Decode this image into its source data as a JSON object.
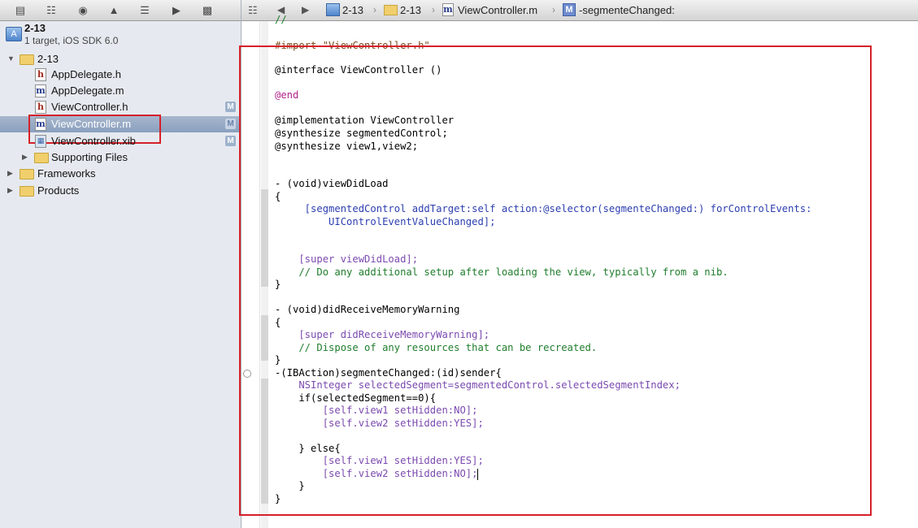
{
  "navigator": {
    "toolbar_icons": [
      "folder-icon",
      "hierarchy-icon",
      "search-icon",
      "warning-icon",
      "test-icon",
      "breakpoint-icon",
      "log-icon"
    ],
    "project": {
      "title": "2-13",
      "subtitle": "1 target, iOS SDK 6.0"
    },
    "tree": [
      {
        "label": "2-13",
        "kind": "group",
        "expanded": true
      },
      {
        "label": "AppDelegate.h",
        "kind": "h"
      },
      {
        "label": "AppDelegate.m",
        "kind": "m"
      },
      {
        "label": "ViewController.h",
        "kind": "h",
        "badge": "M"
      },
      {
        "label": "ViewController.m",
        "kind": "m",
        "badge": "M",
        "selected": true
      },
      {
        "label": "ViewController.xib",
        "kind": "xib",
        "badge": "M"
      },
      {
        "label": "Supporting Files",
        "kind": "group",
        "expanded": false
      },
      {
        "label": "Frameworks",
        "kind": "group",
        "expanded": false
      },
      {
        "label": "Products",
        "kind": "group",
        "expanded": false
      }
    ],
    "badge_letter": "M"
  },
  "editor_header": {
    "breadcrumbs": [
      "2-13",
      "2-13",
      "ViewController.m",
      "-segmenteChanged:"
    ],
    "method_badge": "M"
  },
  "code": {
    "lines": [
      "//",
      "#import \"ViewController.h\"",
      "@interface ViewController ()",
      "@end",
      "@implementation ViewController",
      "@synthesize segmentedControl;",
      "@synthesize view1,view2;",
      "- (void)viewDidLoad",
      "{",
      "     [segmentedControl addTarget:self action:@selector(segmenteChanged:) forControlEvents:",
      "         UIControlEventValueChanged];",
      "    [super viewDidLoad];",
      "    // Do any additional setup after loading the view, typically from a nib.",
      "}",
      "- (void)didReceiveMemoryWarning",
      "{",
      "    [super didReceiveMemoryWarning];",
      "    // Dispose of any resources that can be recreated.",
      "}",
      "-(IBAction)segmenteChanged:(id)sender{",
      "    NSInteger selectedSegment=segmentedControl.selectedSegmentIndex;",
      "    if(selectedSegment==0){",
      "        [self.view1 setHidden:NO];",
      "        [self.view2 setHidden:YES];",
      "    } else{",
      "        [self.view1 setHidden:YES];",
      "        [self.view2 setHidden:NO];",
      "    }",
      "}"
    ]
  },
  "colors": {
    "selection": "#8aa0bf",
    "annotation_box": "#d6202a",
    "keyword": "#b4238b",
    "comment": "#1f7d2c"
  }
}
